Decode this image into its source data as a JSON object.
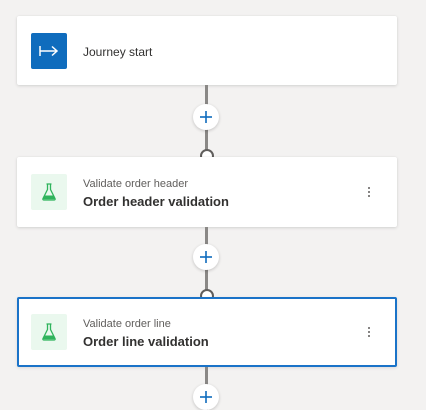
{
  "canvas": {
    "accent_color": "#0f6cbd",
    "selected_border_color": "#1a73c8",
    "flask_color": "#2fb35c"
  },
  "nodes": [
    {
      "icon": "journey-start-icon",
      "label": "Journey start"
    },
    {
      "icon": "flask-icon",
      "subtitle": "Validate order header",
      "title": "Order header validation"
    },
    {
      "icon": "flask-icon",
      "subtitle": "Validate order line",
      "title": "Order line validation",
      "selected": true
    }
  ],
  "add_step_icon": "plus-icon",
  "more_options_icon": "more-vertical-icon"
}
